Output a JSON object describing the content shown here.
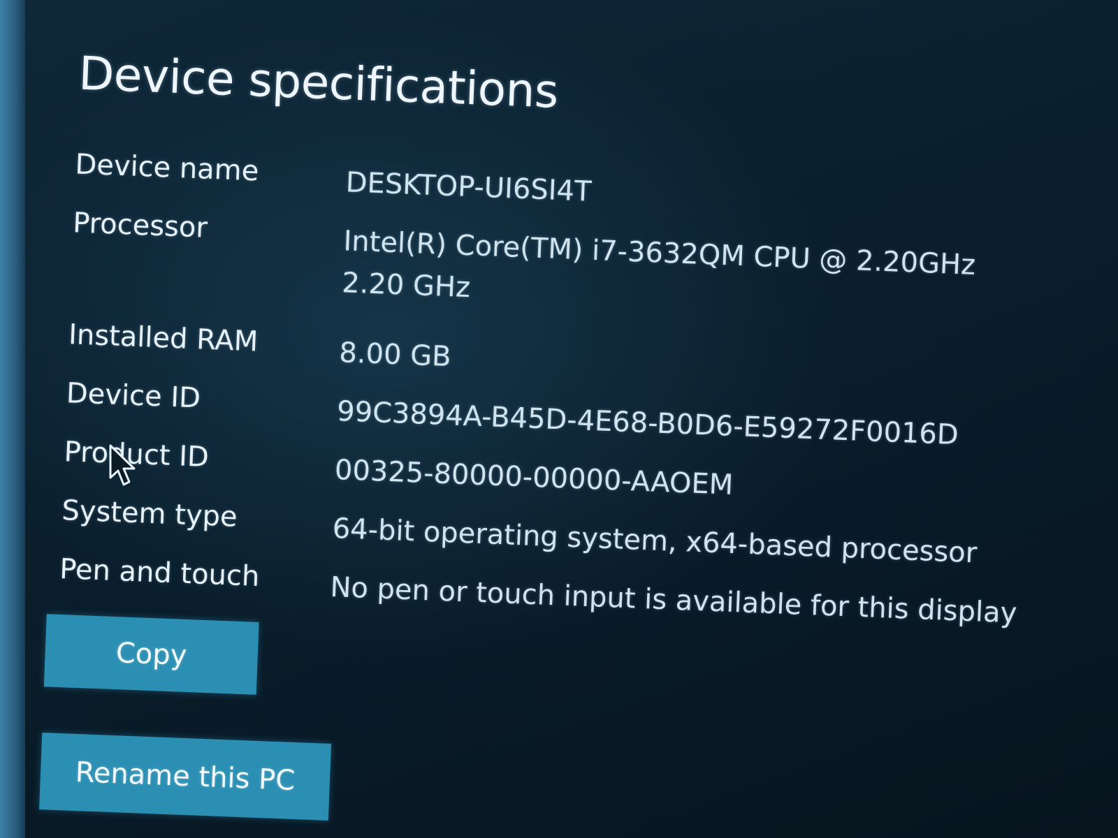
{
  "section": {
    "title": "Device specifications"
  },
  "specs": [
    {
      "label": "Device name",
      "value": "DESKTOP-UI6SI4T",
      "value_line2": ""
    },
    {
      "label": "Processor",
      "value": "Intel(R) Core(TM) i7-3632QM CPU @ 2.20GHz",
      "value_line2": "2.20 GHz"
    },
    {
      "label": "Installed RAM",
      "value": "8.00 GB",
      "value_line2": ""
    },
    {
      "label": "Device ID",
      "value": "99C3894A-B45D-4E68-B0D6-E59272F0016D",
      "value_line2": ""
    },
    {
      "label": "Product ID",
      "value": "00325-80000-00000-AAOEM",
      "value_line2": ""
    },
    {
      "label": "System type",
      "value": "64-bit operating system, x64-based processor",
      "value_line2": ""
    },
    {
      "label": "Pen and touch",
      "value": "No pen or touch input is available for this display",
      "value_line2": ""
    }
  ],
  "buttons": {
    "copy_label": "Copy",
    "rename_label": "Rename this PC"
  },
  "colors": {
    "background": "#0a1f2d",
    "accent_button": "#2b8fb3",
    "text": "#e6f2f8"
  },
  "icons": {
    "pointer": "mouse-pointer-icon"
  }
}
